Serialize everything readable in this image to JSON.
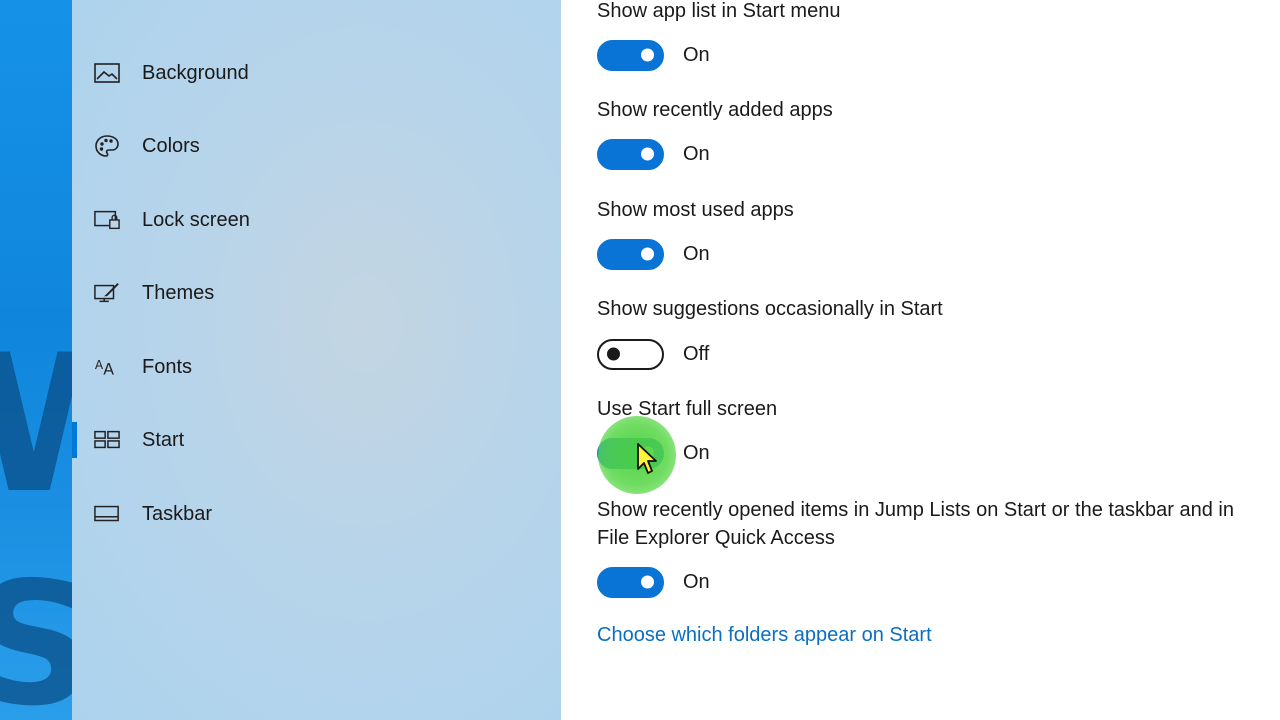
{
  "sidebar": {
    "items": [
      {
        "label": "Background",
        "icon": "picture-icon",
        "selected": false
      },
      {
        "label": "Colors",
        "icon": "palette-icon",
        "selected": false
      },
      {
        "label": "Lock screen",
        "icon": "lock-screen-icon",
        "selected": false
      },
      {
        "label": "Themes",
        "icon": "themes-icon",
        "selected": false
      },
      {
        "label": "Fonts",
        "icon": "fonts-icon",
        "selected": false
      },
      {
        "label": "Start",
        "icon": "start-icon",
        "selected": true
      },
      {
        "label": "Taskbar",
        "icon": "taskbar-icon",
        "selected": false
      }
    ]
  },
  "settings": [
    {
      "title": "Show app list in Start menu",
      "state": "On",
      "on": true
    },
    {
      "title": "Show recently added apps",
      "state": "On",
      "on": true
    },
    {
      "title": "Show most used apps",
      "state": "On",
      "on": true
    },
    {
      "title": "Show suggestions occasionally in Start",
      "state": "Off",
      "on": false
    },
    {
      "title": "Use Start full screen",
      "state": "On",
      "on": true
    },
    {
      "title_line1": "Show recently opened items in Jump Lists on Start or the taskbar and in",
      "title_line2": "File Explorer Quick Access",
      "state": "On",
      "on": true
    }
  ],
  "link": {
    "label": "Choose which folders appear on Start"
  },
  "colors": {
    "accent": "#0a74d6",
    "link": "#0a6fc2",
    "selection_indicator": "#0078d7",
    "cursor_highlight": "#4fd23c"
  }
}
